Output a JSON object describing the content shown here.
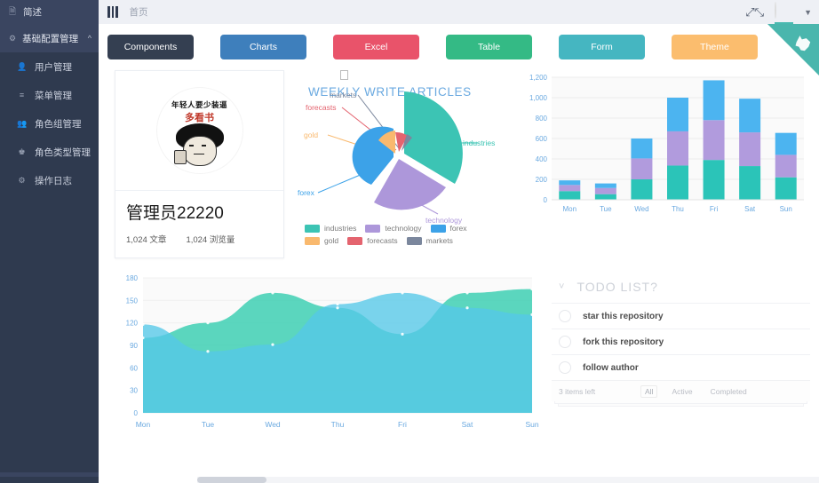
{
  "sidebar": {
    "brand": {
      "label": "简述",
      "icon": "book-icon"
    },
    "group": {
      "label": "基础配置管理",
      "icon": "gear-icon",
      "caret": "chevron-up-icon"
    },
    "items": [
      {
        "label": "用户管理",
        "icon": "user-icon"
      },
      {
        "label": "菜单管理",
        "icon": "list-icon"
      },
      {
        "label": "角色组管理",
        "icon": "users-icon"
      },
      {
        "label": "角色类型管理",
        "icon": "crown-icon"
      },
      {
        "label": "操作日志",
        "icon": "log-icon"
      }
    ]
  },
  "topbar": {
    "menu_icon": "hamburger-icon",
    "breadcrumb": "首页",
    "fullscreen_icon": "fullscreen-icon",
    "caret_icon": "chevron-down-icon",
    "avatar_alt": "avatar"
  },
  "ribbon": {
    "icon": "github-cat-icon",
    "color": "#4ab6ad"
  },
  "tabs": [
    {
      "label": "Components",
      "color": "#343f51"
    },
    {
      "label": "Charts",
      "color": "#3e7fbc"
    },
    {
      "label": "Excel",
      "color": "#e9536a"
    },
    {
      "label": "Table",
      "color": "#34ba85"
    },
    {
      "label": "Form",
      "color": "#45b6c1"
    },
    {
      "label": "Theme",
      "color": "#fbbd6e"
    }
  ],
  "user_card": {
    "name": "管理员22220",
    "stats": [
      {
        "value": "1,024",
        "label": "文章"
      },
      {
        "value": "1,024",
        "label": "浏览量"
      }
    ],
    "meme": {
      "line1": "年轻人要少装逼",
      "line2": "多看书"
    }
  },
  "chart_data": [
    {
      "type": "pie",
      "title": "WEEKLY WRITE ARTICLES",
      "title_color": "#6aa9e0",
      "legend_position": "bottom",
      "labels": [
        "industries",
        "technology",
        "forex",
        "gold",
        "forecasts",
        "markets"
      ],
      "values": [
        320,
        240,
        149,
        100,
        59,
        30
      ],
      "colors": [
        "#3cc4b4",
        "#ad97da",
        "#3ca2e8",
        "#f9b96e",
        "#e4646f",
        "#7b879d"
      ],
      "annotations": [
        "industries",
        "technology",
        "forex",
        "gold",
        "forecasts",
        "markets"
      ]
    },
    {
      "type": "bar",
      "stacked": true,
      "categories": [
        "Mon",
        "Tue",
        "Wed",
        "Thu",
        "Fri",
        "Sat",
        "Sun"
      ],
      "series": [
        {
          "name": "teal",
          "color": "#2bc4b8",
          "values": [
            85,
            55,
            200,
            335,
            390,
            330,
            220
          ]
        },
        {
          "name": "purple",
          "color": "#b19bdd",
          "values": [
            60,
            60,
            205,
            335,
            390,
            330,
            220
          ]
        },
        {
          "name": "blue",
          "color": "#4cb4f0",
          "values": [
            45,
            45,
            195,
            330,
            390,
            330,
            215
          ]
        }
      ],
      "ylim": [
        0,
        1200
      ],
      "yticks": [
        "0",
        "200",
        "400",
        "600",
        "800",
        "1,000",
        "1,200"
      ],
      "xlabel": "",
      "ylabel": "",
      "grid": true
    },
    {
      "type": "area",
      "categories": [
        "Mon",
        "Tue",
        "Wed",
        "Thu",
        "Fri",
        "Sat",
        "Sun"
      ],
      "series": [
        {
          "name": "green",
          "color": "#3ecfb3",
          "values": [
            100,
            120,
            160,
            140,
            105,
            160,
            165
          ]
        },
        {
          "name": "blue",
          "color": "#54c8e8",
          "values": [
            118,
            82,
            91,
            145,
            160,
            140,
            131
          ]
        }
      ],
      "ylim": [
        0,
        180
      ],
      "yticks": [
        "0",
        "30",
        "60",
        "90",
        "120",
        "150",
        "180"
      ],
      "grid": true,
      "legend_position": "none"
    }
  ],
  "todo": {
    "caret_icon": "chevron-down-icon",
    "title": "TODO LIST?",
    "items": [
      {
        "label": "star this repository",
        "done": false
      },
      {
        "label": "fork this repository",
        "done": false
      },
      {
        "label": "follow author",
        "done": false
      }
    ],
    "footer": {
      "count": "3 items left",
      "filters": [
        {
          "label": "All",
          "active": true
        },
        {
          "label": "Active",
          "active": false
        },
        {
          "label": "Completed",
          "active": false
        }
      ]
    }
  }
}
